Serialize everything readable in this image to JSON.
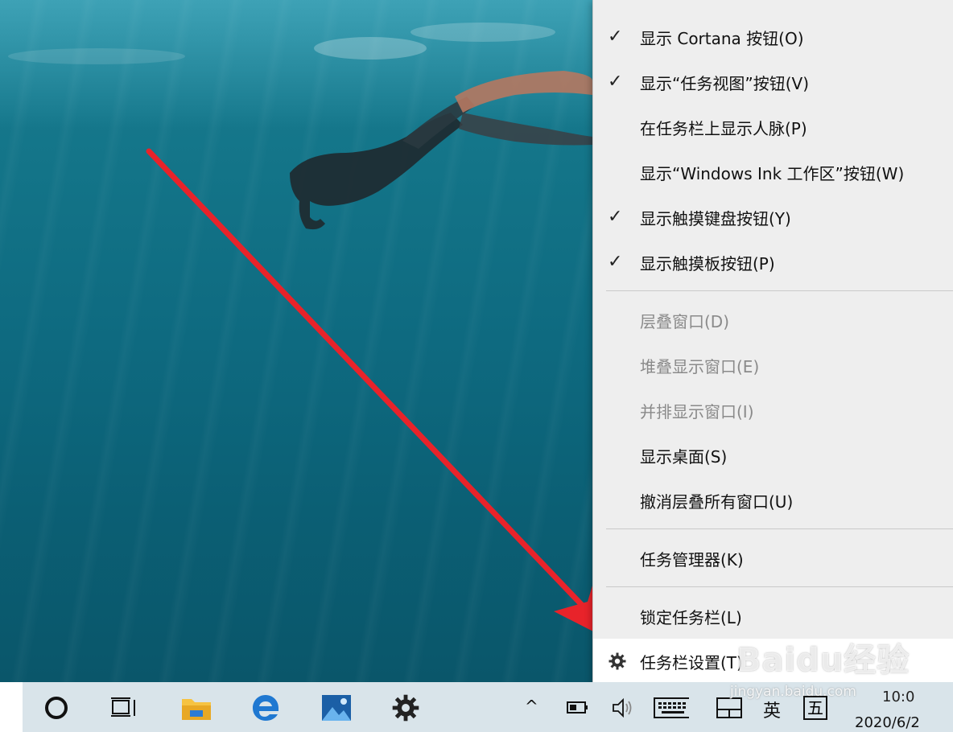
{
  "context_menu": {
    "top_partial_label": "",
    "items": [
      {
        "label": "显示 Cortana 按钮(O)",
        "checked": true,
        "disabled": false
      },
      {
        "label": "显示“任务视图”按钮(V)",
        "checked": true,
        "disabled": false
      },
      {
        "label": "在任务栏上显示人脉(P)",
        "checked": false,
        "disabled": false
      },
      {
        "label": "显示“Windows Ink 工作区”按钮(W)",
        "checked": false,
        "disabled": false
      },
      {
        "label": "显示触摸键盘按钮(Y)",
        "checked": true,
        "disabled": false
      },
      {
        "label": "显示触摸板按钮(P)",
        "checked": true,
        "disabled": false
      },
      {
        "label": "层叠窗口(D)",
        "checked": false,
        "disabled": true
      },
      {
        "label": "堆叠显示窗口(E)",
        "checked": false,
        "disabled": true
      },
      {
        "label": "并排显示窗口(I)",
        "checked": false,
        "disabled": true
      },
      {
        "label": "显示桌面(S)",
        "checked": false,
        "disabled": false
      },
      {
        "label": "撤消层叠所有窗口(U)",
        "checked": false,
        "disabled": false
      },
      {
        "label": "任务管理器(K)",
        "checked": false,
        "disabled": false
      },
      {
        "label": "锁定任务栏(L)",
        "checked": false,
        "disabled": false
      },
      {
        "label": "任务栏设置(T)",
        "checked": false,
        "disabled": false,
        "icon": "gear-icon",
        "highlighted": true
      }
    ],
    "check_glyph": "✓"
  },
  "taskbar": {
    "icons": [
      "cortana-icon",
      "task-view-icon",
      "file-explorer-icon",
      "edge-icon",
      "photos-icon",
      "settings-icon"
    ],
    "tray": {
      "chevron": "^",
      "ime_lang": "英",
      "ime_mode": "五",
      "time_partial": "10:0",
      "date": "2020/6/2"
    }
  },
  "watermark": {
    "brand": "Baidu经验",
    "url": "jingyan.baidu.com"
  },
  "colors": {
    "menu_bg": "#eeeeee",
    "menu_highlight": "#ffffff",
    "taskbar_bg": "#d9e4ea",
    "arrow": "#e8232a",
    "edge_blue": "#1f78d1",
    "folder_yellow": "#f6c342"
  }
}
